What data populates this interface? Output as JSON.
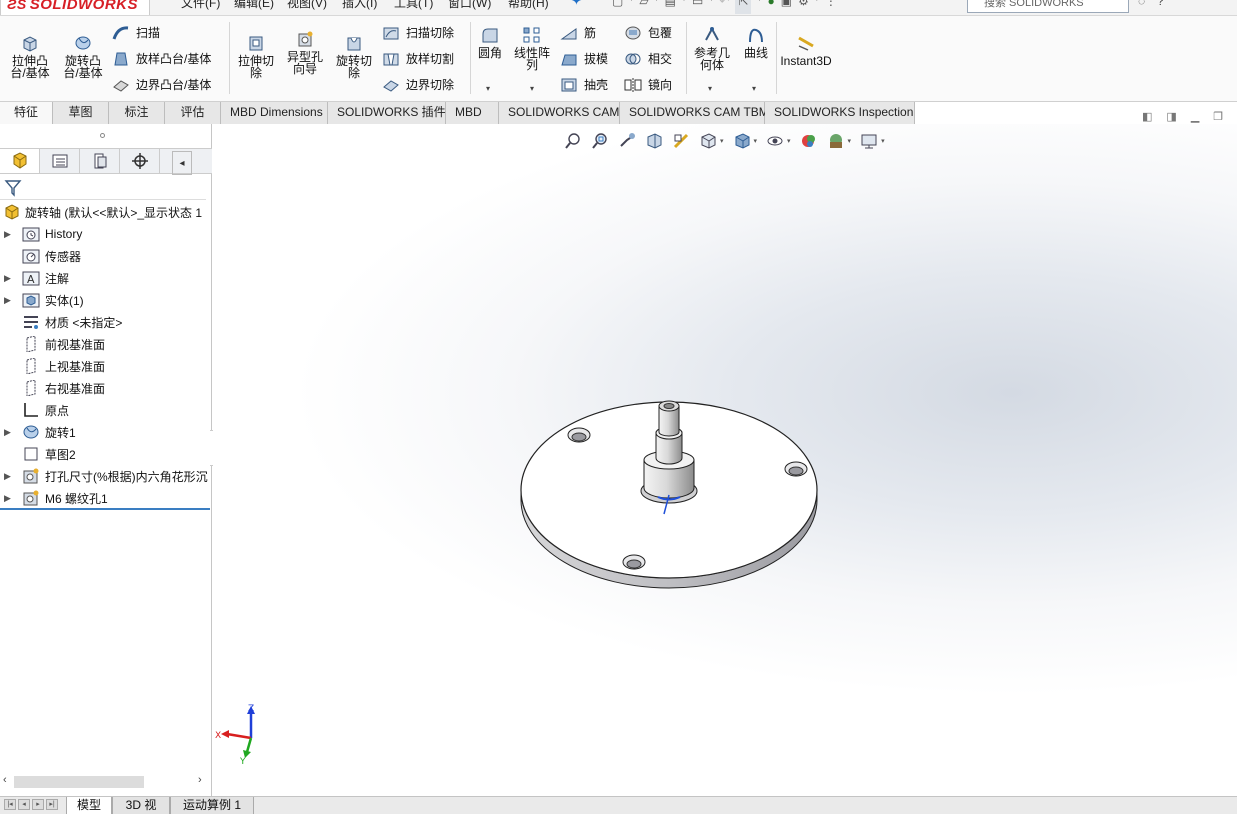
{
  "app": {
    "logo_text": "SOLIDWORKS",
    "menus": [
      "文件(F)",
      "编辑(E)",
      "视图(V)",
      "插入(I)",
      "工具(T)",
      "窗口(W)",
      "帮助(H)"
    ],
    "search_placeholder": "搜索 SOLIDWORKS"
  },
  "ribbon": {
    "extrude_boss": "拉伸凸\n台/基体",
    "revolve_boss": "旋转凸\n台/基体",
    "sweep": "扫描",
    "loft_boss": "放样凸台/基体",
    "boundary_boss": "边界凸台/基体",
    "extrude_cut": "拉伸切\n除",
    "hole_wizard": "异型孔\n向导",
    "revolve_cut": "旋转切\n除",
    "sweep_cut": "扫描切除",
    "loft_cut": "放样切割",
    "boundary_cut": "边界切除",
    "fillet": "圆角",
    "linear_pattern": "线性阵\n列",
    "rib": "筋",
    "draft": "拔模",
    "shell": "抽壳",
    "wrap": "包覆",
    "intersect": "相交",
    "mirror": "镜向",
    "ref_geometry": "参考几\n何体",
    "curves": "曲线",
    "instant3d": "Instant3D"
  },
  "tabs": [
    "特征",
    "草图",
    "标注",
    "评估",
    "MBD Dimensions",
    "SOLIDWORKS 插件",
    "MBD",
    "SOLIDWORKS CAM",
    "SOLIDWORKS CAM TBM",
    "SOLIDWORKS Inspection"
  ],
  "tree": {
    "root": "旋转轴  (默认<<默认>_显示状态 1",
    "items": [
      "History",
      "传感器",
      "注解",
      "实体(1)",
      "材质 <未指定>",
      "前视基准面",
      "上视基准面",
      "右视基准面",
      "原点",
      "旋转1",
      "草图2",
      "打孔尺寸(%根据)内六角花形沉",
      "M6 螺纹孔1"
    ]
  },
  "triad": {
    "x": "X",
    "y": "Y",
    "z": "Z"
  },
  "bottom_tabs": [
    "模型",
    "3D 视图",
    "运动算例 1"
  ],
  "colors": {
    "accent": "#1f6fc7",
    "brand": "#d71f26",
    "tree_end": "#3a7ec2"
  }
}
